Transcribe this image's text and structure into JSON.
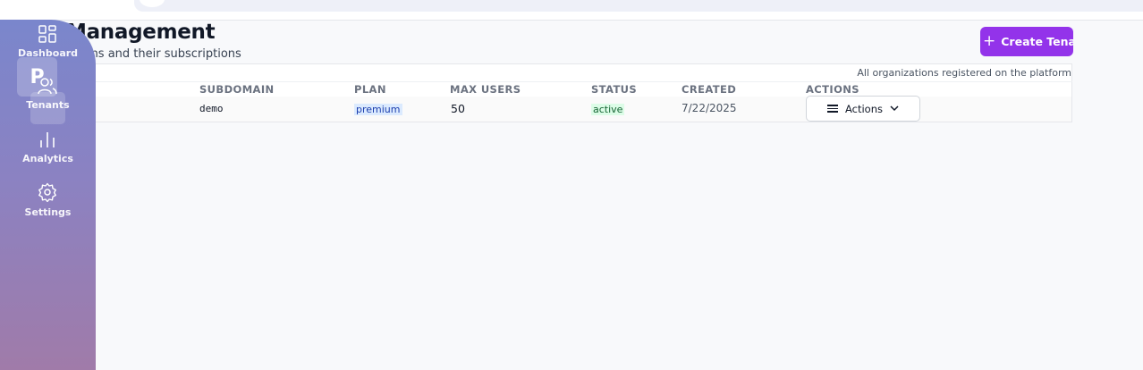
{
  "header": {
    "title": "Management",
    "subtitle": "ions and their subscriptions",
    "create_label": "Create Tenant",
    "create_icon": "plus-icon"
  },
  "card": {
    "description": "All organizations registered on the platform"
  },
  "table": {
    "columns": [
      "SUBDOMAIN",
      "PLAN",
      "MAX USERS",
      "STATUS",
      "CREATED",
      "ACTIONS"
    ],
    "rows": [
      {
        "subdomain": "demo",
        "plan": "premium",
        "max_users": "50",
        "status": "active",
        "created": "7/22/2025",
        "actions_label": "Actions"
      }
    ]
  },
  "sidebar": {
    "logo": "P",
    "items": [
      {
        "label": "Dashboard",
        "icon": "grid-icon"
      },
      {
        "label": "Tenants",
        "icon": "users-icon",
        "active": true
      },
      {
        "label": "Analytics",
        "icon": "bar-chart-icon"
      },
      {
        "label": "Settings",
        "icon": "gear-icon"
      }
    ]
  },
  "colors": {
    "accent": "#9333ea",
    "sidebar_top": "#7a86cc",
    "sidebar_bottom": "#a07ba9",
    "plan_badge": "#dbeafe",
    "status_badge": "#dcfce7"
  }
}
